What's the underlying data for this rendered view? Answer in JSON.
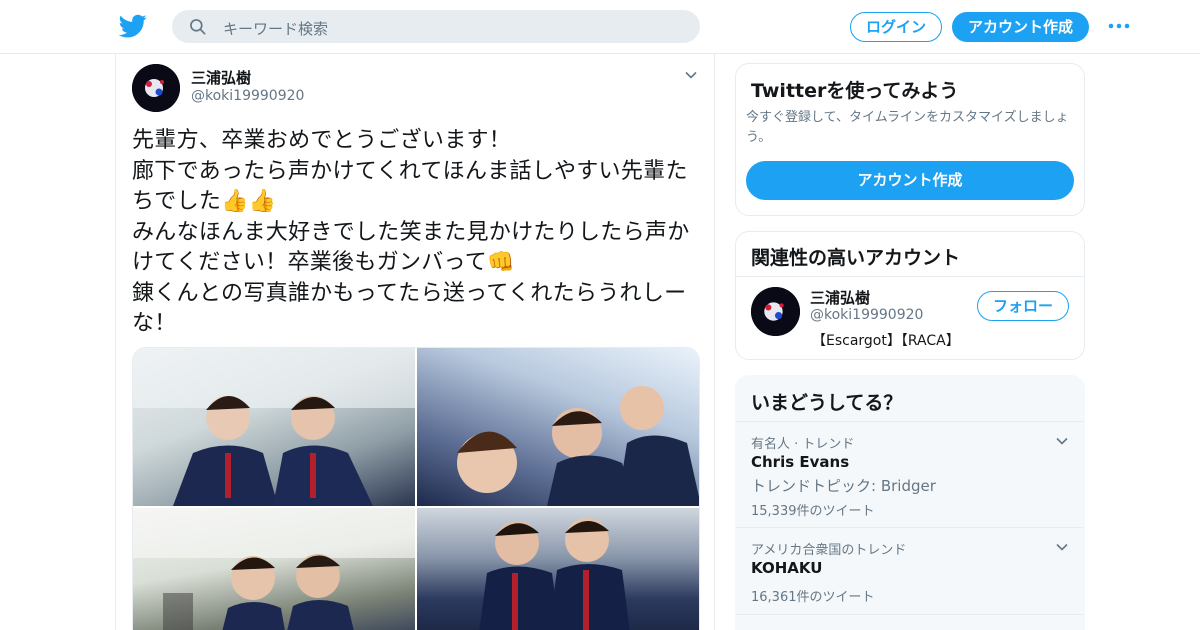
{
  "header": {
    "search_placeholder": "キーワード検索",
    "login_label": "ログイン",
    "signup_label": "アカウント作成",
    "icons": [
      "twitter-bird-icon",
      "search-icon",
      "more-icon"
    ]
  },
  "tweet": {
    "author_name": "三浦弘樹",
    "author_handle": "@koki19990920",
    "text": "先輩方、卒業おめでとうございます！\n廊下であったら声かけてくれてほんま話しやすい先輩たちでした👍👍\nみんなほんま大好きでした笑また見かけたりしたら声かけてください！卒業後もガンバって👊\n錬くんとの写真誰かもってたら送ってくれたらうれしーな！"
  },
  "sidebar": {
    "signup_card": {
      "title": "Twitterを使ってみよう",
      "description": "今すぐ登録して、タイムラインをカスタマイズしましょう。",
      "button_label": "アカウント作成"
    },
    "related_card": {
      "title": "関連性の高いアカウント",
      "account": {
        "name": "三浦弘樹",
        "handle": "@koki19990920",
        "bio": "【Escargot】【RACA】",
        "follow_label": "フォロー"
      }
    },
    "trends_card": {
      "title": "いまどうしてる？",
      "trends": [
        {
          "category": "有名人 · トレンド",
          "name": "Chris Evans",
          "subtitle": "トレンドトピック: Bridger",
          "count": "15,339件のツイート"
        },
        {
          "category": "アメリカ合衆国のトレンド",
          "name": "KOHAKU",
          "subtitle": "",
          "count": "16,361件のツイート"
        }
      ]
    }
  },
  "colors": {
    "accent": "#1da1f2",
    "text": "#14171a",
    "muted": "#657786",
    "border": "#e6ecf0"
  }
}
